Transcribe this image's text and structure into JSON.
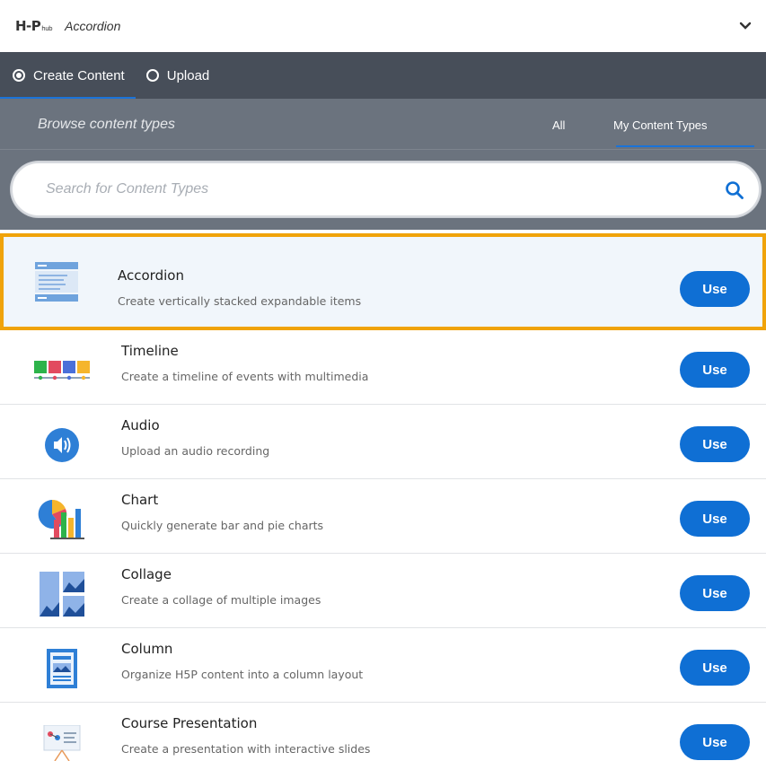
{
  "header": {
    "logo": "H-P",
    "logo_sub": "hub",
    "breadcrumb": "Accordion"
  },
  "tabs": [
    {
      "label": "Create Content",
      "selected": true
    },
    {
      "label": "Upload",
      "selected": false
    }
  ],
  "browse": {
    "title": "Browse content types",
    "filter_all": "All",
    "filter_mine": "My Content Types"
  },
  "search": {
    "placeholder": "Search for Content Types",
    "value": ""
  },
  "content_types": [
    {
      "title": "Accordion",
      "description": "Create vertically stacked expandable items",
      "icon": "accordion-icon",
      "button": "Use"
    },
    {
      "title": "Timeline",
      "description": "Create a timeline of events with multimedia",
      "icon": "timeline-icon",
      "button": "Use"
    },
    {
      "title": "Audio",
      "description": "Upload an audio recording",
      "icon": "audio-icon",
      "button": "Use"
    },
    {
      "title": "Chart",
      "description": "Quickly generate bar and pie charts",
      "icon": "chart-icon",
      "button": "Use"
    },
    {
      "title": "Collage",
      "description": "Create a collage of multiple images",
      "icon": "collage-icon",
      "button": "Use"
    },
    {
      "title": "Column",
      "description": "Organize H5P content into a column layout",
      "icon": "column-icon",
      "button": "Use"
    },
    {
      "title": "Course Presentation",
      "description": "Create a presentation with interactive slides",
      "icon": "course-presentation-icon",
      "button": "Use"
    }
  ],
  "colors": {
    "highlight_border": "#f0a30a",
    "use_button": "#0f6fd4",
    "tabs_bg": "#474e59",
    "browse_bg": "#6b737e"
  }
}
